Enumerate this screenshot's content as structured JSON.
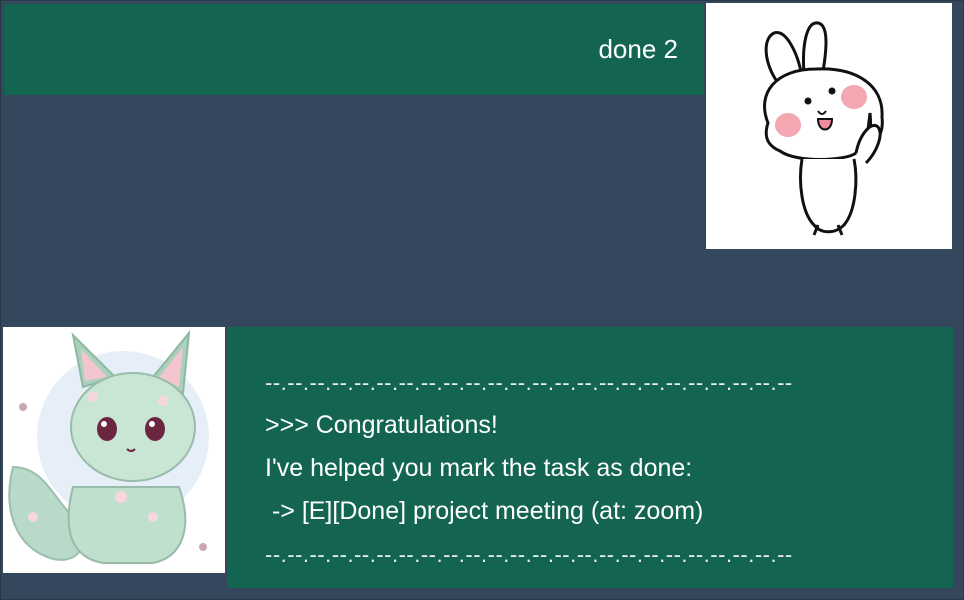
{
  "messages": {
    "user": {
      "text": "done 2",
      "avatar_icon": "bunny-avatar-icon"
    },
    "bot": {
      "avatar_icon": "green-fox-avatar-icon",
      "lines": [
        "--.--.--.--.--.--.--.--.--.--.--.--.--.--.--.--.--.--.--.--.--.--.--.--",
        ">>> Congratulations!",
        "I've helped you mark the task as done:",
        " -> [E][Done] project meeting (at: zoom)",
        "--.--.--.--.--.--.--.--.--.--.--.--.--.--.--.--.--.--.--.--.--.--.--.--"
      ]
    }
  },
  "colors": {
    "background": "#34475c",
    "bubble": "#136552",
    "text": "#ffffff"
  }
}
